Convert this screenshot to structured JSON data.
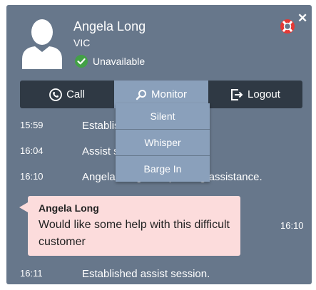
{
  "header": {
    "agent_name": "Angela Long",
    "location": "VIC",
    "status": "Unavailable",
    "status_color": "#43a047"
  },
  "toolbar": {
    "call_label": "Call",
    "monitor_label": "Monitor",
    "logout_label": "Logout"
  },
  "monitor_menu": {
    "items": [
      "Silent",
      "Whisper",
      "Barge In"
    ]
  },
  "messages": [
    {
      "time": "15:59",
      "text": "Established assist session."
    },
    {
      "time": "16:04",
      "text": "Assist session ended."
    },
    {
      "time": "16:10",
      "text": "Angela Long is requesting assistance."
    }
  ],
  "chat_bubble": {
    "author": "Angela Long",
    "text": "Would like some help with this difficult customer",
    "time": "16:10"
  },
  "last_message": {
    "time": "16:11",
    "text": "Established assist session."
  },
  "colors": {
    "panel": "#67778b",
    "toolbar": "#2f3944",
    "monitor_active": "#8aa0bb",
    "bubble": "#fcdcdc"
  }
}
